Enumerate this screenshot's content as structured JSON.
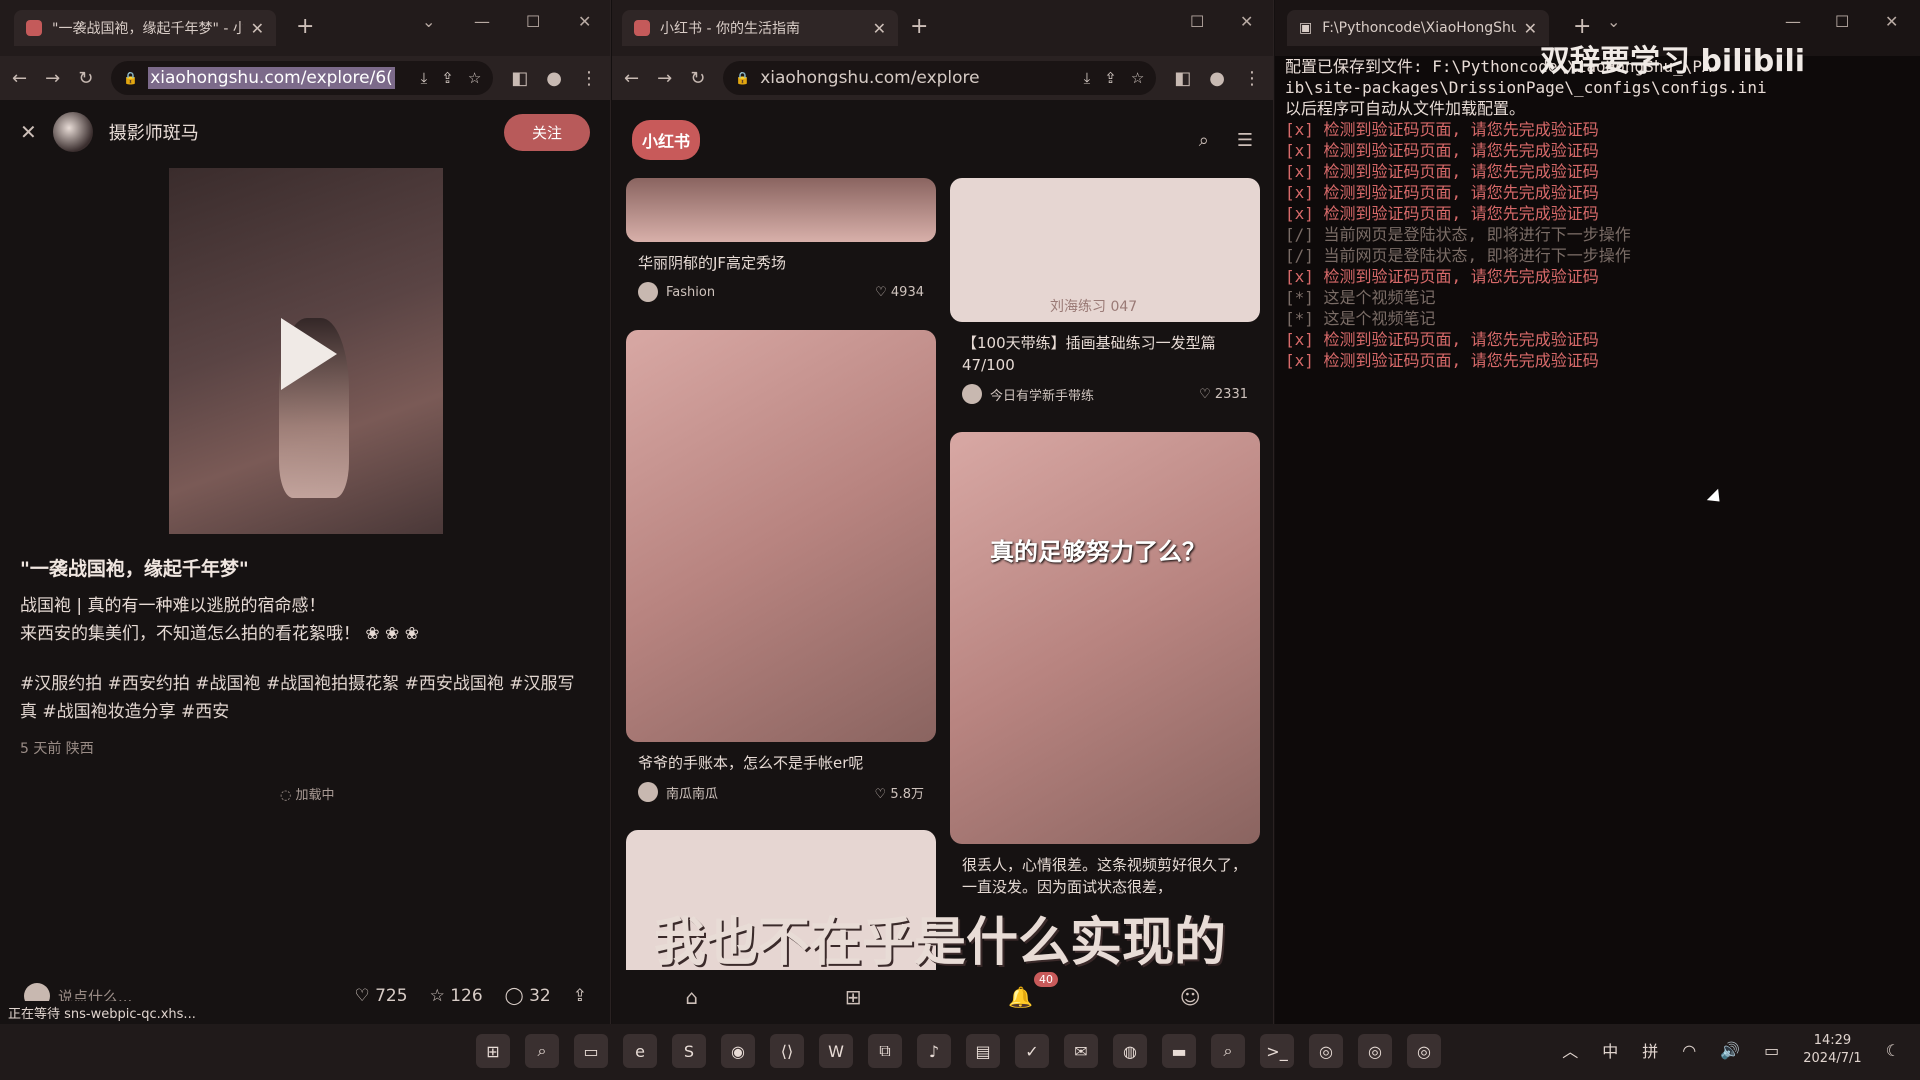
{
  "left": {
    "tab_title": "\"一袭战国袍，缘起千年梦\" - 小红",
    "url": "xiaohongshu.com/explore/6(",
    "author": "摄影师斑马",
    "follow": "关注",
    "title": "\"一袭战国袍，缘起千年梦\"",
    "body": "战国袍 | 真的有一种难以逃脱的宿命感！\n来西安的集美们，不知道怎么拍的看花絮哦！ ❀ ❀ ❀",
    "tags": "#汉服约拍 #西安约拍 #战国袍 #战国袍拍摄花絮 #西安战国袍 #汉服写真 #战国袍妆造分享 #西安",
    "meta": "5 天前 陕西",
    "loading": "加载中",
    "say": "说点什么...",
    "likes": "725",
    "stars": "126",
    "comments": "32",
    "status": "正在等待 sns-webpic-qc.xhs..."
  },
  "middle": {
    "tab_title": "小红书 - 你的生活指南",
    "url": "xiaohongshu.com/explore",
    "logo": "小红书",
    "cards": [
      {
        "title": "华丽阴郁的JF高定秀场",
        "author": "Fashion",
        "likes": "4934"
      },
      {
        "title": "【100天带练】插画基础练习一发型篇47/100",
        "author": "今日有学新手带练",
        "likes": "2331",
        "img_text": "刘海练习  047"
      },
      {
        "title": "爷爷的手账本，怎么不是手帐er呢",
        "author": "南瓜南瓜",
        "likes": "5.8万"
      },
      {
        "title": "很丢人，心情很差。这条视频剪好很久了，一直没发。因为面试状态很差，",
        "author": "",
        "likes": "",
        "img_text": "真的足够努力了么？"
      }
    ],
    "caption": "我也不在乎是什么实现的",
    "badge": "40"
  },
  "terminal": {
    "tab_title": "F:\\Pythoncode\\XiaoHongShu",
    "lines": [
      {
        "t": "配置已保存到文件: F:\\Pythoncode\\XiaoHongShu_\\PA",
        "c": "ok"
      },
      {
        "t": "ib\\site-packages\\DrissionPage\\_configs\\configs.ini",
        "c": "ok"
      },
      {
        "t": "以后程序可自动从文件加载配置。",
        "c": "ok"
      },
      {
        "t": "[x] 检测到验证码页面, 请您先完成验证码",
        "c": "err"
      },
      {
        "t": "[x] 检测到验证码页面, 请您先完成验证码",
        "c": "err"
      },
      {
        "t": "[x] 检测到验证码页面, 请您先完成验证码",
        "c": "err"
      },
      {
        "t": "[x] 检测到验证码页面, 请您先完成验证码",
        "c": "err"
      },
      {
        "t": "[x] 检测到验证码页面, 请您先完成验证码",
        "c": "err"
      },
      {
        "t": "[/] 当前网页是登陆状态, 即将进行下一步操作",
        "c": "dim"
      },
      {
        "t": "[/] 当前网页是登陆状态, 即将进行下一步操作",
        "c": "dim"
      },
      {
        "t": "[x] 检测到验证码页面, 请您先完成验证码",
        "c": "err"
      },
      {
        "t": "[*] 这是个视频笔记",
        "c": "dim"
      },
      {
        "t": "[*] 这是个视频笔记",
        "c": "dim"
      },
      {
        "t": "[x] 检测到验证码页面, 请您先完成验证码",
        "c": "err"
      },
      {
        "t": "[x] 检测到验证码页面, 请您先完成验证码",
        "c": "err"
      }
    ],
    "watermark": "双辞要学习 bilibili"
  },
  "taskbar": {
    "ime": "中",
    "ime2": "拼",
    "time": "14:29",
    "date": "2024/7/1"
  }
}
